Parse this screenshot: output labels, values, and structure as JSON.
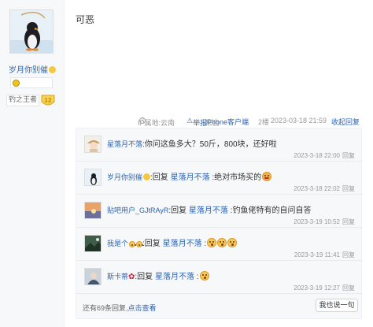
{
  "author": {
    "username": "岁月你别催",
    "badge_title": "钓之王者",
    "badge_level": "12"
  },
  "post": {
    "text": "可恶"
  },
  "meta": {
    "ip": "IP属地:云南",
    "report": "举报",
    "source_prefix": "来自",
    "source_client": "iPhone客户端",
    "floor": "2楼",
    "time": "2023-03-18 21:59",
    "collapse": "收起回复"
  },
  "replies": [
    {
      "user": "星落月不落",
      "prefix": ":",
      "target": "",
      "content": "你问这鱼多大？50斤，800块，还好啦",
      "time": "2023-3-18 22:00",
      "action": "回复"
    },
    {
      "user": "岁月你别催",
      "prefix": ":回复",
      "target": "星落月不落",
      "content": ":绝对市场买的",
      "time": "2023-3-18 22:02",
      "action": "回复"
    },
    {
      "user": "贴吧用户_GJtRAyR",
      "prefix": ":回复",
      "target": "星落月不落",
      "content": ":钓鱼佬特有的自问自答",
      "time": "2023-3-19 10:52",
      "action": "回复"
    },
    {
      "user": "我是个",
      "prefix": ":回复",
      "target": "星落月不落",
      "content": ":",
      "time": "2023-3-19 11:41",
      "action": "回复"
    },
    {
      "user": "斯卡蒂",
      "prefix": ":回复",
      "target": "星落月不落",
      "content": ":",
      "time": "2023-3-19 12:27",
      "action": "回复"
    }
  ],
  "footer": {
    "count_text": "还有69条回复,",
    "view_link": "点击查看",
    "reply_button": "我也说一句"
  },
  "colors": {
    "link": "#2d64b3",
    "meta_gray": "#999999",
    "panel_bg": "#f7f8fa"
  }
}
